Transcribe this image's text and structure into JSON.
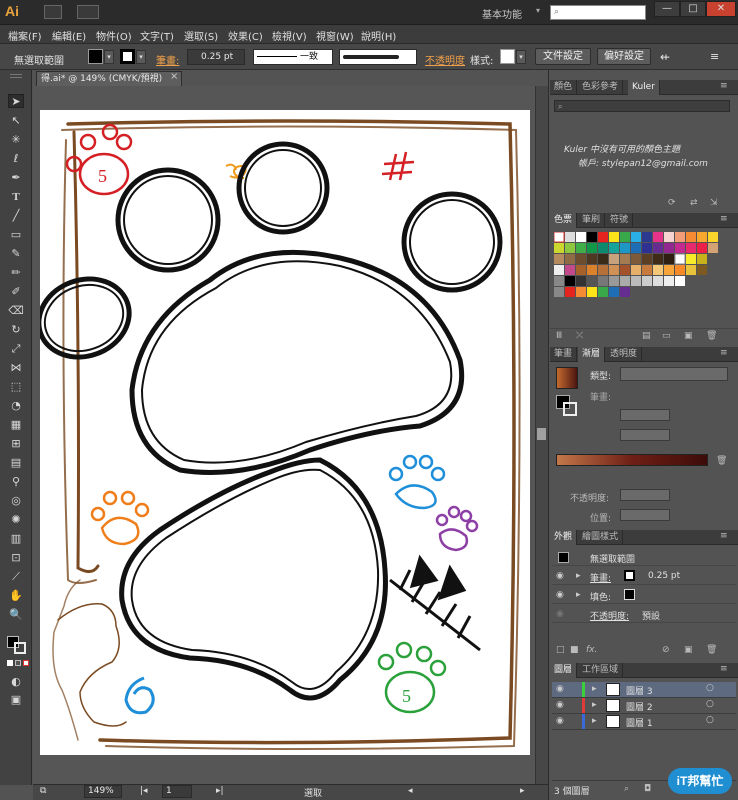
{
  "app": {
    "logo": "Ai",
    "workspace": "基本功能",
    "workspace_arrow": "▾",
    "search_placeholder": "",
    "min": "—",
    "max": "□",
    "close": "✕"
  },
  "menu": [
    "檔案(F)",
    "編輯(E)",
    "物件(O)",
    "文字(T)",
    "選取(S)",
    "效果(C)",
    "檢視(V)",
    "視窗(W)",
    "說明(H)"
  ],
  "control": {
    "selection": "無選取範圍",
    "stroke_label": "筆畫:",
    "stroke_value": "0.25 pt",
    "profile": "一致",
    "opacity_link": "不透明度",
    "style_label": "樣式:",
    "doc_setup": "文件設定",
    "prefs": "偏好設定"
  },
  "document": {
    "tab_title": "得.ai* @ 149% (CMYK/預視)",
    "tab_close": "×"
  },
  "status": {
    "zoom": "149%",
    "page": "1",
    "mode": "選取"
  },
  "colors": {
    "bg": "#535353",
    "accent": "#f0a04a",
    "frame": "#7a4a22",
    "red": "#d42024",
    "orange": "#ef7d1a",
    "blue": "#1e8fd8",
    "purple": "#8d3fa6",
    "green": "#2aa13a"
  },
  "panels": {
    "top_tabs": [
      "顏色",
      "色彩參考",
      "Kuler"
    ],
    "kuler_msg1": "Kuler 中沒有可用的顏色主題",
    "kuler_msg2": "帳戶: stylepan12@gmail.com",
    "swatch_tabs": [
      "色票",
      "筆刷",
      "符號"
    ],
    "gradient_tabs": [
      "筆畫",
      "漸層",
      "透明度"
    ],
    "gradient_type_label": "類型:",
    "gradient_stroke_label": "筆畫:",
    "gradient_opacity_label": "不透明度:",
    "gradient_position_label": "位置:",
    "appearance_tabs": [
      "外觀",
      "繪圖樣式"
    ],
    "appearance_title": "無選取範圍",
    "appearance_stroke": "筆畫:",
    "appearance_stroke_value": "0.25 pt",
    "appearance_fill": "填色:",
    "appearance_opacity": "不透明度:",
    "appearance_opacity_value": "預設",
    "appearance_fx": "fx.",
    "layers_tabs": [
      "圖層",
      "工作區域"
    ],
    "layers": [
      {
        "name": "圖層 3",
        "color": "#3ad13a"
      },
      {
        "name": "圖層 2",
        "color": "#e03a3a"
      },
      {
        "name": "圖層 1",
        "color": "#3a6ad8"
      }
    ],
    "layers_count": "3 個圖層",
    "watermark": "iT邦幫忙"
  },
  "artwork": {
    "paw_red_number": "5",
    "paw_green_number": "5"
  }
}
